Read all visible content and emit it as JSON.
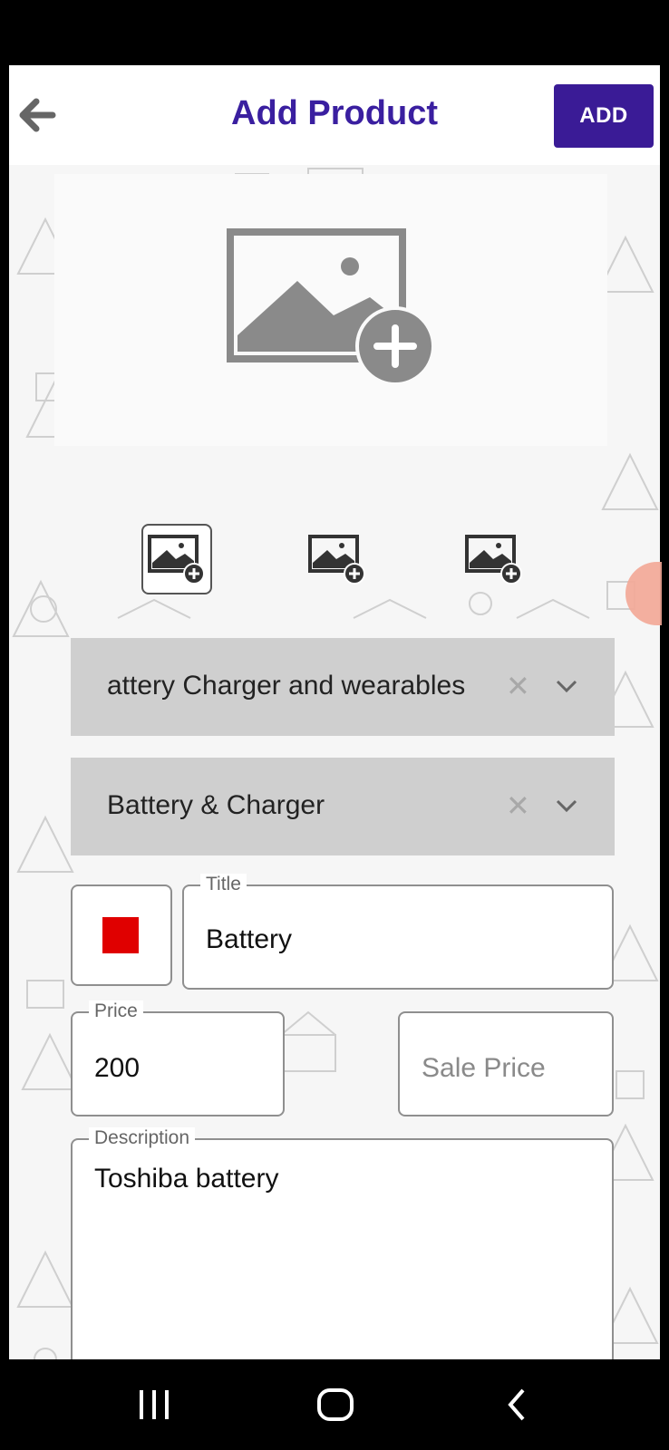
{
  "header": {
    "back_icon": "arrow-left-icon",
    "title": "Add Product",
    "add_label": "ADD"
  },
  "images": {
    "main_icon": "add-image-icon",
    "thumbnails": [
      "add-image-icon",
      "add-image-icon",
      "add-image-icon"
    ],
    "selected_thumbnail": 0
  },
  "category": {
    "value": "attery Charger and wearables",
    "clear_icon": "close-icon",
    "dropdown_icon": "chevron-down-icon"
  },
  "subcategory": {
    "value": "Battery & Charger",
    "clear_icon": "close-icon",
    "dropdown_icon": "chevron-down-icon"
  },
  "color": {
    "value": "#e00000"
  },
  "title_field": {
    "label": "Title",
    "value": "Battery"
  },
  "price_field": {
    "label": "Price",
    "value": "200"
  },
  "sale_price_field": {
    "placeholder": "Sale Price"
  },
  "description_field": {
    "label": "Description",
    "value": "Toshiba battery"
  },
  "navbar": {
    "items": [
      "recent-apps-icon",
      "home-icon",
      "back-icon"
    ]
  },
  "colors": {
    "accent": "#3a1b96",
    "title": "#3a1fa0"
  }
}
